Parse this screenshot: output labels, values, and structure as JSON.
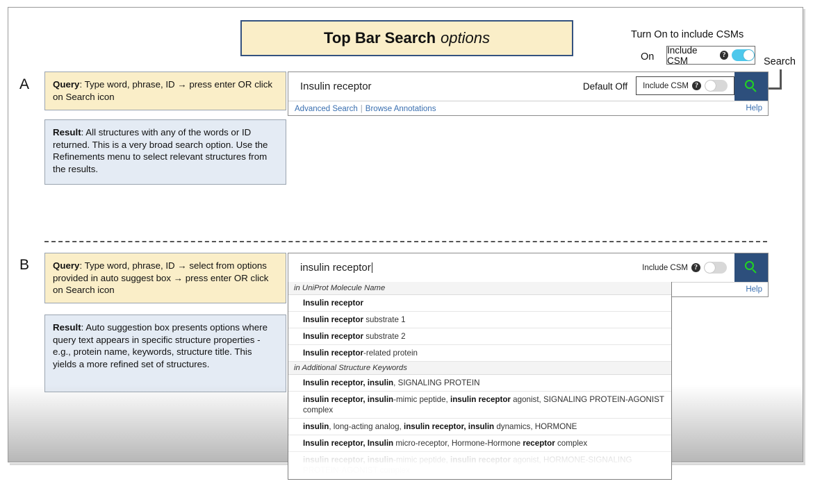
{
  "title": {
    "strong": "Top Bar Search",
    "em": "options"
  },
  "annotations": {
    "csm_note": "Turn On to include CSMs",
    "on_label": "On",
    "search_label": "Search",
    "row_a_letter": "A",
    "row_b_letter": "B"
  },
  "csm_toggle_top": {
    "label": "Include CSM",
    "help_glyph": "?",
    "state": "on"
  },
  "rows": [
    {
      "letter": "A",
      "query_prefix": "Query",
      "query_text": ": Type word, phrase, ID → press enter OR click on Search icon",
      "result_prefix": "Result",
      "result_text": ": All structures with any of the words or ID returned. This is a very broad search option. Use the Refinements menu to select relevant structures from the results.",
      "search_value": "Insulin receptor",
      "default_off_label": "Default Off",
      "csm_label": "Include CSM",
      "csm_state": "off",
      "advanced_search": "Advanced Search",
      "browse_annotations": "Browse Annotations",
      "help": "Help"
    },
    {
      "letter": "B",
      "query_prefix": "Query",
      "query_text": ": Type word, phrase, ID → select from options provided in auto suggest box → press enter OR click on Search icon",
      "result_prefix": "Result",
      "result_text": ": Auto suggestion box presents options where query text appears in specific structure properties - e.g., protein name, keywords, structure title. This yields a more refined set of structures.",
      "search_value": "insulin receptor",
      "csm_label": "Include CSM",
      "csm_state": "off",
      "help": "Help"
    }
  ],
  "autosuggest": {
    "groups": [
      {
        "label": "in UniProt Molecule Name",
        "items": [
          [
            {
              "t": "Insulin receptor",
              "b": true
            }
          ],
          [
            {
              "t": "Insulin receptor",
              "b": true
            },
            {
              "t": " substrate 1",
              "b": false
            }
          ],
          [
            {
              "t": "Insulin receptor",
              "b": true
            },
            {
              "t": " substrate 2",
              "b": false
            }
          ],
          [
            {
              "t": "Insulin receptor",
              "b": true
            },
            {
              "t": "-related protein",
              "b": false
            }
          ]
        ]
      },
      {
        "label": "in Additional Structure Keywords",
        "items": [
          [
            {
              "t": "Insulin receptor, insulin",
              "b": true
            },
            {
              "t": ", SIGNALING PROTEIN",
              "b": false
            }
          ],
          [
            {
              "t": "insulin receptor, insulin",
              "b": true
            },
            {
              "t": "-mimic peptide, ",
              "b": false
            },
            {
              "t": "insulin receptor",
              "b": true
            },
            {
              "t": " agonist, SIGNALING PROTEIN-AGONIST complex",
              "b": false
            }
          ],
          [
            {
              "t": "insulin",
              "b": true
            },
            {
              "t": ", long-acting analog, ",
              "b": false
            },
            {
              "t": "insulin receptor, insulin",
              "b": true
            },
            {
              "t": " dynamics, HORMONE",
              "b": false
            }
          ],
          [
            {
              "t": "Insulin receptor, Insulin",
              "b": true
            },
            {
              "t": " micro-receptor, Hormone-Hormone ",
              "b": false
            },
            {
              "t": "receptor",
              "b": true
            },
            {
              "t": " complex",
              "b": false
            }
          ],
          [
            {
              "t": "insulin receptor, insulin",
              "b": true
            },
            {
              "t": "-mimic peptide, ",
              "b": false
            },
            {
              "t": "insulin receptor",
              "b": true
            },
            {
              "t": " agonist, HORMONE-SIGNALING PROTEIN-AGONIST complex",
              "b": false
            }
          ]
        ]
      }
    ]
  },
  "colors": {
    "banner_bg": "#faeec8",
    "banner_border": "#34527f",
    "query_bg": "#faeec8",
    "result_bg": "#e4ebf4",
    "search_button": "#2d4f7c",
    "magnifier_green": "#22d422",
    "toggle_on": "#4ec8ec",
    "toggle_off": "#d8d8d8",
    "link_blue": "#3a6fb0"
  }
}
